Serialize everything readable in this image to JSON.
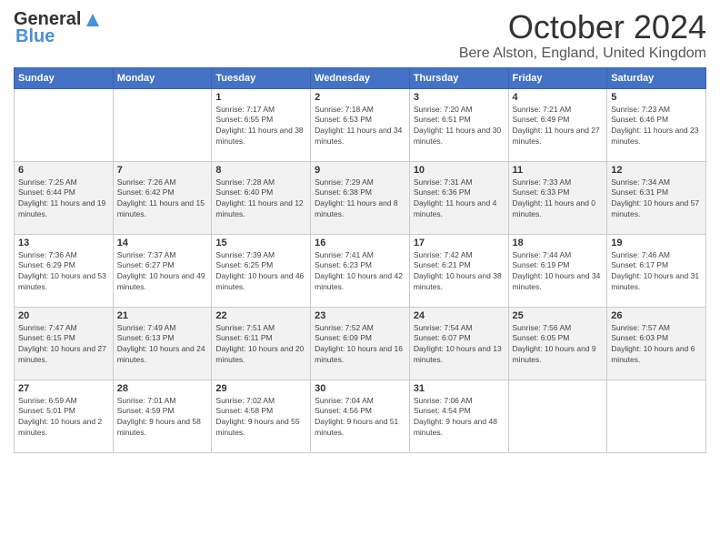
{
  "header": {
    "logo_general": "General",
    "logo_blue": "Blue",
    "month_title": "October 2024",
    "location": "Bere Alston, England, United Kingdom"
  },
  "weekdays": [
    "Sunday",
    "Monday",
    "Tuesday",
    "Wednesday",
    "Thursday",
    "Friday",
    "Saturday"
  ],
  "weeks": [
    [
      {
        "day": "",
        "sunrise": "",
        "sunset": "",
        "daylight": ""
      },
      {
        "day": "",
        "sunrise": "",
        "sunset": "",
        "daylight": ""
      },
      {
        "day": "1",
        "sunrise": "Sunrise: 7:17 AM",
        "sunset": "Sunset: 6:55 PM",
        "daylight": "Daylight: 11 hours and 38 minutes."
      },
      {
        "day": "2",
        "sunrise": "Sunrise: 7:18 AM",
        "sunset": "Sunset: 6:53 PM",
        "daylight": "Daylight: 11 hours and 34 minutes."
      },
      {
        "day": "3",
        "sunrise": "Sunrise: 7:20 AM",
        "sunset": "Sunset: 6:51 PM",
        "daylight": "Daylight: 11 hours and 30 minutes."
      },
      {
        "day": "4",
        "sunrise": "Sunrise: 7:21 AM",
        "sunset": "Sunset: 6:49 PM",
        "daylight": "Daylight: 11 hours and 27 minutes."
      },
      {
        "day": "5",
        "sunrise": "Sunrise: 7:23 AM",
        "sunset": "Sunset: 6:46 PM",
        "daylight": "Daylight: 11 hours and 23 minutes."
      }
    ],
    [
      {
        "day": "6",
        "sunrise": "Sunrise: 7:25 AM",
        "sunset": "Sunset: 6:44 PM",
        "daylight": "Daylight: 11 hours and 19 minutes."
      },
      {
        "day": "7",
        "sunrise": "Sunrise: 7:26 AM",
        "sunset": "Sunset: 6:42 PM",
        "daylight": "Daylight: 11 hours and 15 minutes."
      },
      {
        "day": "8",
        "sunrise": "Sunrise: 7:28 AM",
        "sunset": "Sunset: 6:40 PM",
        "daylight": "Daylight: 11 hours and 12 minutes."
      },
      {
        "day": "9",
        "sunrise": "Sunrise: 7:29 AM",
        "sunset": "Sunset: 6:38 PM",
        "daylight": "Daylight: 11 hours and 8 minutes."
      },
      {
        "day": "10",
        "sunrise": "Sunrise: 7:31 AM",
        "sunset": "Sunset: 6:36 PM",
        "daylight": "Daylight: 11 hours and 4 minutes."
      },
      {
        "day": "11",
        "sunrise": "Sunrise: 7:33 AM",
        "sunset": "Sunset: 6:33 PM",
        "daylight": "Daylight: 11 hours and 0 minutes."
      },
      {
        "day": "12",
        "sunrise": "Sunrise: 7:34 AM",
        "sunset": "Sunset: 6:31 PM",
        "daylight": "Daylight: 10 hours and 57 minutes."
      }
    ],
    [
      {
        "day": "13",
        "sunrise": "Sunrise: 7:36 AM",
        "sunset": "Sunset: 6:29 PM",
        "daylight": "Daylight: 10 hours and 53 minutes."
      },
      {
        "day": "14",
        "sunrise": "Sunrise: 7:37 AM",
        "sunset": "Sunset: 6:27 PM",
        "daylight": "Daylight: 10 hours and 49 minutes."
      },
      {
        "day": "15",
        "sunrise": "Sunrise: 7:39 AM",
        "sunset": "Sunset: 6:25 PM",
        "daylight": "Daylight: 10 hours and 46 minutes."
      },
      {
        "day": "16",
        "sunrise": "Sunrise: 7:41 AM",
        "sunset": "Sunset: 6:23 PM",
        "daylight": "Daylight: 10 hours and 42 minutes."
      },
      {
        "day": "17",
        "sunrise": "Sunrise: 7:42 AM",
        "sunset": "Sunset: 6:21 PM",
        "daylight": "Daylight: 10 hours and 38 minutes."
      },
      {
        "day": "18",
        "sunrise": "Sunrise: 7:44 AM",
        "sunset": "Sunset: 6:19 PM",
        "daylight": "Daylight: 10 hours and 34 minutes."
      },
      {
        "day": "19",
        "sunrise": "Sunrise: 7:46 AM",
        "sunset": "Sunset: 6:17 PM",
        "daylight": "Daylight: 10 hours and 31 minutes."
      }
    ],
    [
      {
        "day": "20",
        "sunrise": "Sunrise: 7:47 AM",
        "sunset": "Sunset: 6:15 PM",
        "daylight": "Daylight: 10 hours and 27 minutes."
      },
      {
        "day": "21",
        "sunrise": "Sunrise: 7:49 AM",
        "sunset": "Sunset: 6:13 PM",
        "daylight": "Daylight: 10 hours and 24 minutes."
      },
      {
        "day": "22",
        "sunrise": "Sunrise: 7:51 AM",
        "sunset": "Sunset: 6:11 PM",
        "daylight": "Daylight: 10 hours and 20 minutes."
      },
      {
        "day": "23",
        "sunrise": "Sunrise: 7:52 AM",
        "sunset": "Sunset: 6:09 PM",
        "daylight": "Daylight: 10 hours and 16 minutes."
      },
      {
        "day": "24",
        "sunrise": "Sunrise: 7:54 AM",
        "sunset": "Sunset: 6:07 PM",
        "daylight": "Daylight: 10 hours and 13 minutes."
      },
      {
        "day": "25",
        "sunrise": "Sunrise: 7:56 AM",
        "sunset": "Sunset: 6:05 PM",
        "daylight": "Daylight: 10 hours and 9 minutes."
      },
      {
        "day": "26",
        "sunrise": "Sunrise: 7:57 AM",
        "sunset": "Sunset: 6:03 PM",
        "daylight": "Daylight: 10 hours and 6 minutes."
      }
    ],
    [
      {
        "day": "27",
        "sunrise": "Sunrise: 6:59 AM",
        "sunset": "Sunset: 5:01 PM",
        "daylight": "Daylight: 10 hours and 2 minutes."
      },
      {
        "day": "28",
        "sunrise": "Sunrise: 7:01 AM",
        "sunset": "Sunset: 4:59 PM",
        "daylight": "Daylight: 9 hours and 58 minutes."
      },
      {
        "day": "29",
        "sunrise": "Sunrise: 7:02 AM",
        "sunset": "Sunset: 4:58 PM",
        "daylight": "Daylight: 9 hours and 55 minutes."
      },
      {
        "day": "30",
        "sunrise": "Sunrise: 7:04 AM",
        "sunset": "Sunset: 4:56 PM",
        "daylight": "Daylight: 9 hours and 51 minutes."
      },
      {
        "day": "31",
        "sunrise": "Sunrise: 7:06 AM",
        "sunset": "Sunset: 4:54 PM",
        "daylight": "Daylight: 9 hours and 48 minutes."
      },
      {
        "day": "",
        "sunrise": "",
        "sunset": "",
        "daylight": ""
      },
      {
        "day": "",
        "sunrise": "",
        "sunset": "",
        "daylight": ""
      }
    ]
  ]
}
